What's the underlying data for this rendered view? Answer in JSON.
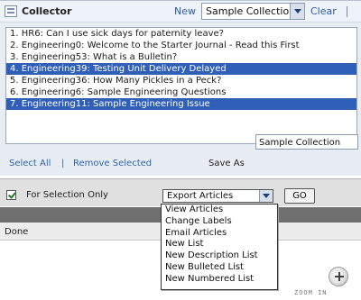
{
  "header": {
    "title": "Collector",
    "new_label": "New",
    "collection_selected": "Sample Collection",
    "clear_label": "Clear"
  },
  "articles": [
    {
      "label": "1. HR6: Can I use sick days for paternity leave?",
      "selected": false
    },
    {
      "label": "2. Engineering0: Welcome to the Starter Journal - Read this First",
      "selected": false
    },
    {
      "label": "3. Engineering53: What is a Bulletin?",
      "selected": false
    },
    {
      "label": "4. Engineering39: Testing Unit Delivery Delayed",
      "selected": true
    },
    {
      "label": "5. Engineering36: How Many Pickles in a Peck?",
      "selected": false
    },
    {
      "label": "6. Engineering6: Sample Engineering Questions",
      "selected": false
    },
    {
      "label": "7. Engineering11: Sample Engineering Issue",
      "selected": true
    }
  ],
  "list_actions": {
    "select_all": "Select All",
    "separator": "|",
    "remove_selected": "Remove Selected",
    "save_as_label": "Save As",
    "save_as_value": "Sample Collection"
  },
  "selection": {
    "checked": true,
    "label": "For Selection Only",
    "export_selected": "Export Articles",
    "go_label": "GO"
  },
  "export_menu": {
    "items": [
      "View Articles",
      "Change Labels",
      "Email Articles",
      "New List",
      "New Description List",
      "New Bulleted List",
      "New Numbered List"
    ]
  },
  "status": {
    "text": "Done"
  },
  "zoom": {
    "label": "ZOOM IN"
  },
  "colors": {
    "selection_highlight": "#2f5fb7",
    "link": "#2e63a7",
    "panel_bg": "#e8edf3",
    "dark_band": "#6f6f6f"
  },
  "icons": [
    "app-icon",
    "chevron-down-icon",
    "checkbox-check-icon",
    "zoom-in-icon"
  ]
}
